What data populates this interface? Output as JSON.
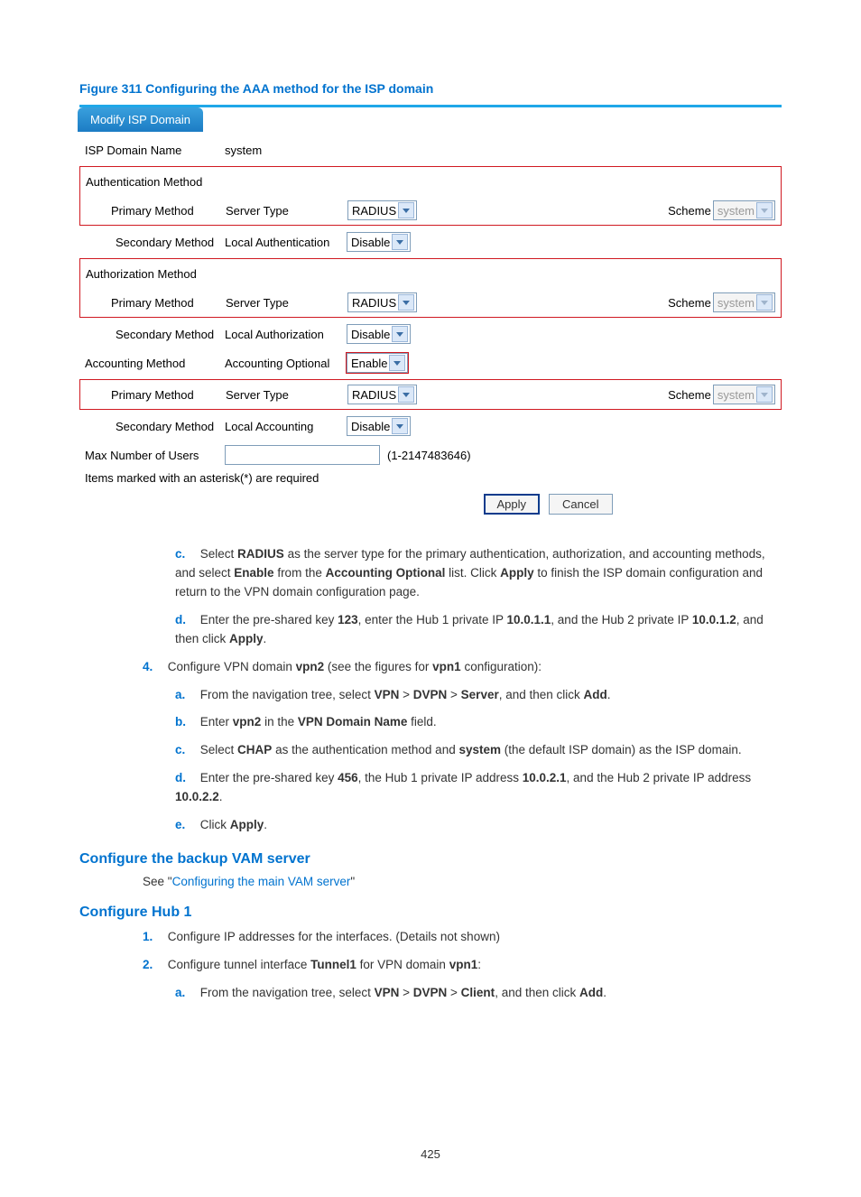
{
  "figure_title": "Figure 311 Configuring the AAA method for the ISP domain",
  "panel": {
    "tab": "Modify ISP Domain",
    "isp_domain_label": "ISP Domain Name",
    "isp_domain_value": "system",
    "auth_method_label": "Authentication Method",
    "primary_method_label": "Primary Method",
    "server_type_label": "Server Type",
    "secondary_method_label": "Secondary Method",
    "scheme_label": "Scheme",
    "local_auth_label": "Local Authentication",
    "authz_method_label": "Authorization Method",
    "local_authz_label": "Local Authorization",
    "acct_method_label": "Accounting Method",
    "acct_optional_label": "Accounting Optional",
    "local_acct_label": "Local Accounting",
    "max_users_label": "Max Number of Users",
    "max_users_hint": "(1-2147483646)",
    "footnote": "Items marked with an asterisk(*) are required",
    "select": {
      "radius": "RADIUS",
      "system": "system",
      "disable": "Disable",
      "enable": "Enable"
    },
    "apply": "Apply",
    "cancel": "Cancel"
  },
  "steps": {
    "c": {
      "marker": "c.",
      "p1a": "Select ",
      "p1b": "RADIUS",
      "p1c": " as the server type for the primary authentication, authorization, and accounting methods, and select ",
      "p1d": "Enable",
      "p1e": " from the ",
      "p1f": "Accounting Optional",
      "p1g": " list. Click ",
      "p1h": "Apply",
      "p1i": " to finish the ISP domain configuration and return to the VPN domain configuration page."
    },
    "d": {
      "marker": "d.",
      "p1a": "Enter the pre-shared key ",
      "p1b": "123",
      "p1c": ", enter the Hub 1 private IP ",
      "p1d": "10.0.1.1",
      "p1e": ", and the Hub 2 private IP ",
      "p1f": "10.0.1.2",
      "p1g": ", and then click ",
      "p1h": "Apply",
      "p1i": "."
    },
    "s4": {
      "marker": "4.",
      "p1a": "Configure VPN domain ",
      "p1b": "vpn2",
      "p1c": " (see the figures for ",
      "p1d": "vpn1",
      "p1e": " configuration):"
    },
    "s4a": {
      "marker": "a.",
      "p1a": "From the navigation tree, select ",
      "p1b": "VPN",
      "p1c": " > ",
      "p1d": "DVPN",
      "p1e": " > ",
      "p1f": "Server",
      "p1g": ", and then click ",
      "p1h": "Add",
      "p1i": "."
    },
    "s4b": {
      "marker": "b.",
      "p1a": "Enter ",
      "p1b": "vpn2",
      "p1c": " in the ",
      "p1d": "VPN Domain Name",
      "p1e": " field."
    },
    "s4c": {
      "marker": "c.",
      "p1a": "Select ",
      "p1b": "CHAP",
      "p1c": " as the authentication method and ",
      "p1d": "system",
      "p1e": " (the default ISP domain) as the ISP domain."
    },
    "s4d": {
      "marker": "d.",
      "p1a": "Enter the pre-shared key ",
      "p1b": "456",
      "p1c": ", the Hub 1 private IP address ",
      "p1d": "10.0.2.1",
      "p1e": ", and the Hub 2 private IP address ",
      "p1f": "10.0.2.2",
      "p1g": "."
    },
    "s4e": {
      "marker": "e.",
      "p1a": "Click ",
      "p1b": "Apply",
      "p1c": "."
    }
  },
  "h_backup": "Configure the backup VAM server",
  "see_a": "See \"",
  "see_link": "Configuring the main VAM server",
  "see_b": "\"",
  "h_hub1": "Configure Hub 1",
  "hub1": {
    "s1": {
      "marker": "1.",
      "text": "Configure IP addresses for the interfaces. (Details not shown)"
    },
    "s2": {
      "marker": "2.",
      "p1a": "Configure tunnel interface ",
      "p1b": "Tunnel1",
      "p1c": " for VPN domain ",
      "p1d": "vpn1",
      "p1e": ":"
    },
    "s2a": {
      "marker": "a.",
      "p1a": "From the navigation tree, select ",
      "p1b": "VPN",
      "p1c": " > ",
      "p1d": "DVPN",
      "p1e": " > ",
      "p1f": "Client",
      "p1g": ", and then click ",
      "p1h": "Add",
      "p1i": "."
    }
  },
  "page_number": "425"
}
